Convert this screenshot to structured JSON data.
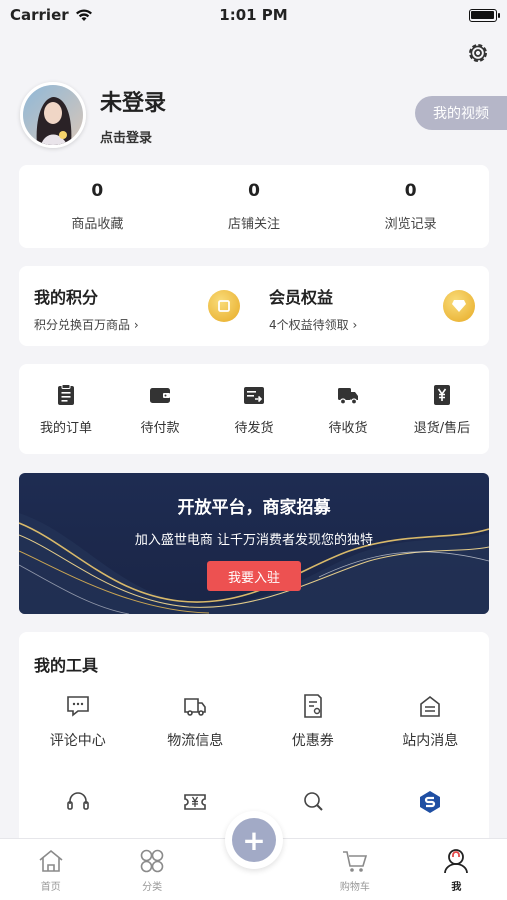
{
  "status": {
    "carrier": "Carrier",
    "time": "1:01 PM",
    "battery_level": 1.0
  },
  "profile": {
    "nickname": "未登录",
    "login_text": "点击登录",
    "video_button": "我的视频"
  },
  "stats": [
    {
      "value": "0",
      "label": "商品收藏"
    },
    {
      "value": "0",
      "label": "店铺关注"
    },
    {
      "value": "0",
      "label": "浏览记录"
    }
  ],
  "points": {
    "title": "我的积分",
    "subtitle": "积分兑换百万商品",
    "member_title": "会员权益",
    "member_subtitle": "4个权益待领取"
  },
  "orders": [
    {
      "label": "我的订单",
      "icon": "clipboard-icon"
    },
    {
      "label": "待付款",
      "icon": "wallet-icon"
    },
    {
      "label": "待发货",
      "icon": "ship-box-icon"
    },
    {
      "label": "待收货",
      "icon": "truck-icon"
    },
    {
      "label": "退货/售后",
      "icon": "refund-icon"
    }
  ],
  "banner": {
    "title": "开放平台，商家招募",
    "subtitle": "加入盛世电商 让千万消费者发现您的独特",
    "button": "我要入驻"
  },
  "tools": {
    "title": "我的工具",
    "items": [
      {
        "label": "评论中心",
        "icon": "comment-icon"
      },
      {
        "label": "物流信息",
        "icon": "delivery-icon"
      },
      {
        "label": "优惠券",
        "icon": "coupon-icon"
      },
      {
        "label": "站内消息",
        "icon": "message-icon"
      },
      {
        "label": "",
        "icon": "headset-icon"
      },
      {
        "label": "",
        "icon": "ticket-icon"
      },
      {
        "label": "",
        "icon": "search-doc-icon"
      },
      {
        "label": "",
        "icon": "brand-logo-icon"
      }
    ]
  },
  "tabbar": [
    {
      "label": "首页",
      "icon": "home-icon"
    },
    {
      "label": "分类",
      "icon": "category-icon"
    },
    {
      "label": "",
      "icon": "add-icon"
    },
    {
      "label": "购物车",
      "icon": "cart-icon"
    },
    {
      "label": "我",
      "icon": "user-icon"
    }
  ],
  "colors": {
    "accent_red": "#ed5151",
    "coin_gold": "#e7aa25",
    "banner_navy": "#1e2c52",
    "video_pill": "#b5b6c8"
  }
}
